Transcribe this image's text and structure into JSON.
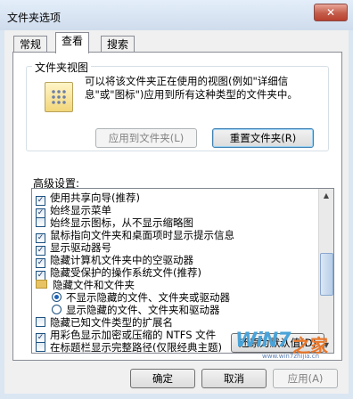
{
  "window": {
    "title": "文件夹选项",
    "close_glyph": "✕"
  },
  "tabs": [
    {
      "label": "常规"
    },
    {
      "label": "查看"
    },
    {
      "label": "搜索"
    }
  ],
  "folder_views": {
    "title": "文件夹视图",
    "icon": "folder-view-icon",
    "description": "可以将该文件夹正在使用的视图(例如\"详细信息\"或\"图标\")应用到所有这种类型的文件夹中。",
    "apply_label": "应用到文件夹(L)",
    "reset_label": "重置文件夹(R)"
  },
  "advanced": {
    "label": "高级设置:",
    "items": [
      {
        "kind": "checkbox",
        "checked": true,
        "label": "使用共享向导(推荐)"
      },
      {
        "kind": "checkbox",
        "checked": true,
        "label": "始终显示菜单"
      },
      {
        "kind": "checkbox",
        "checked": false,
        "label": "始终显示图标，从不显示缩略图"
      },
      {
        "kind": "checkbox",
        "checked": true,
        "label": "鼠标指向文件夹和桌面项时显示提示信息"
      },
      {
        "kind": "checkbox",
        "checked": true,
        "label": "显示驱动器号"
      },
      {
        "kind": "checkbox",
        "checked": true,
        "label": "隐藏计算机文件夹中的空驱动器"
      },
      {
        "kind": "checkbox",
        "checked": true,
        "label": "隐藏受保护的操作系统文件(推荐)"
      },
      {
        "kind": "folder",
        "label": "隐藏文件和文件夹"
      },
      {
        "kind": "radio",
        "checked": true,
        "label": "不显示隐藏的文件、文件夹或驱动器"
      },
      {
        "kind": "radio",
        "checked": false,
        "label": "显示隐藏的文件、文件夹和驱动器"
      },
      {
        "kind": "checkbox",
        "checked": false,
        "label": "隐藏已知文件类型的扩展名"
      },
      {
        "kind": "checkbox",
        "checked": true,
        "label": "用彩色显示加密或压缩的 NTFS 文件"
      },
      {
        "kind": "checkbox",
        "checked": false,
        "label": "在标题栏显示完整路径(仅限经典主题)"
      }
    ],
    "check_glyph": "✓",
    "scroll_up_glyph": "▲",
    "scroll_down_glyph": "▼",
    "restore_label": "还原为默认值(D)"
  },
  "footer": {
    "ok_label": "确定",
    "cancel_label": "取消",
    "apply_label": "应用(A)"
  },
  "watermark": {
    "text": "WiN7",
    "suffix": "之家",
    "url": "www.win7zhijia.cn"
  }
}
